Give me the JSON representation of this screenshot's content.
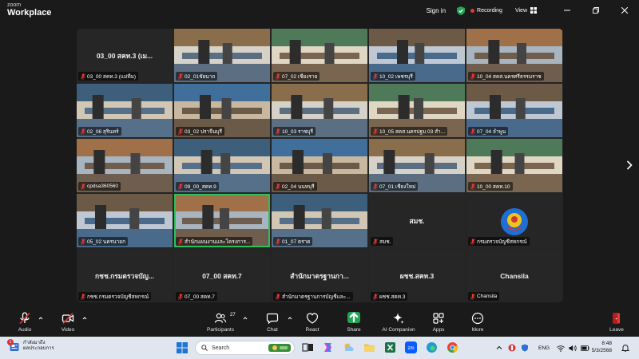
{
  "app": {
    "zoom_label": "zoom",
    "workplace_label": "Workplace"
  },
  "titlebar": {
    "sign_in": "Sign in",
    "recording": "Recording",
    "view": "View"
  },
  "tiles": [
    {
      "row": 0,
      "col": 0,
      "type": "text",
      "center": "03_00 สคท.3 (เม...",
      "name": "03_00 สคท.3 (แม่ทีม)"
    },
    {
      "row": 0,
      "col": 1,
      "type": "cam",
      "name": "02_01ชัยนาถ"
    },
    {
      "row": 0,
      "col": 2,
      "type": "cam",
      "name": "07_02 เชียงราย"
    },
    {
      "row": 0,
      "col": 3,
      "type": "cam",
      "name": "10_02 เพชรบุรี"
    },
    {
      "row": 0,
      "col": 4,
      "type": "cam",
      "name": "10_04 สคส.นครศรีธรรมราช"
    },
    {
      "row": 1,
      "col": 0,
      "type": "cam",
      "name": "02_06 สุรินทร์"
    },
    {
      "row": 1,
      "col": 1,
      "type": "cam",
      "name": "03_02 ปราจีนบุรี"
    },
    {
      "row": 1,
      "col": 2,
      "type": "cam",
      "name": "10_03 ราชบุรี"
    },
    {
      "row": 1,
      "col": 3,
      "type": "cam",
      "name": "10_05 สคส.นครปฐม 03 สำ..."
    },
    {
      "row": 1,
      "col": 4,
      "type": "cam",
      "name": "07_04 ลำพูน"
    },
    {
      "row": 2,
      "col": 0,
      "type": "cam",
      "name": "cpdsa360560"
    },
    {
      "row": 2,
      "col": 1,
      "type": "cam",
      "name": "09_00_สคท.9"
    },
    {
      "row": 2,
      "col": 2,
      "type": "cam",
      "name": "02_04 นนทบุรี"
    },
    {
      "row": 2,
      "col": 3,
      "type": "cam",
      "name": "07_01 เชียงใหม่"
    },
    {
      "row": 2,
      "col": 4,
      "type": "cam",
      "name": "10_00 สคท.10"
    },
    {
      "row": 3,
      "col": 0,
      "type": "cam",
      "name": "05_02 นครนายก"
    },
    {
      "row": 3,
      "col": 1,
      "type": "cam",
      "active": true,
      "name": "สำนักแผนงานและโครงการ..."
    },
    {
      "row": 3,
      "col": 2,
      "type": "cam",
      "name": "01_07 ตราด"
    },
    {
      "row": 3,
      "col": 3,
      "type": "text",
      "center": "สมช.",
      "name": "สมช."
    },
    {
      "row": 3,
      "col": 4,
      "type": "avatar",
      "name": "กรมตรวจบัญชีสหกรณ์"
    },
    {
      "row": 4,
      "col": 0,
      "type": "text",
      "center": "กชช.กรมตรวจบัญ...",
      "name": "กชช.กรมตรวจบัญชีสหกรณ์"
    },
    {
      "row": 4,
      "col": 1,
      "type": "text",
      "center": "07_00 สคท.7",
      "name": "07_00 สคท.7"
    },
    {
      "row": 4,
      "col": 2,
      "type": "text",
      "center": "สำนักมาตรฐานกา...",
      "name": "สำนักมาตรฐานการบัญชีและ..."
    },
    {
      "row": 4,
      "col": 3,
      "type": "text",
      "center": "ผชช.สคท.3",
      "name": "ผชช.สคท.3"
    },
    {
      "row": 4,
      "col": 4,
      "type": "text",
      "center": "Chansila",
      "name": "Chansila"
    }
  ],
  "toolbar": {
    "audio": "Audio",
    "video": "Video",
    "participants": "Participants",
    "participants_count": "27",
    "chat": "Chat",
    "react": "React",
    "share": "Share",
    "ai_companion": "AI Companion",
    "apps": "Apps",
    "more": "More",
    "leave": "Leave"
  },
  "taskbar": {
    "weather_line1": "กำลังมาถึง",
    "weather_line2": "ผลประกอบการ",
    "weather_badge": "1",
    "search_placeholder": "Search",
    "language": "ENG",
    "time": "8:48",
    "date": "5/3/2568"
  },
  "colors": {
    "background": "#1a1a1a",
    "gallery": "#242424",
    "active_speaker": "#2fbf5a",
    "mute_red": "#e53935",
    "share_green": "#23a455",
    "taskbar": "#dfe6ef"
  }
}
